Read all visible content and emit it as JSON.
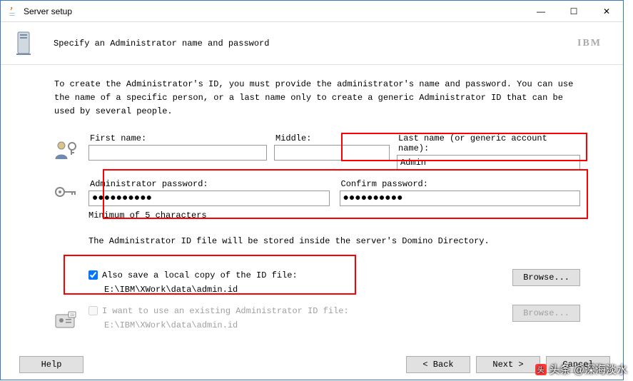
{
  "window": {
    "title": "Server setup"
  },
  "titlebar": {
    "min": "—",
    "max": "☐",
    "close": "✕"
  },
  "header": {
    "subtitle": "Specify an Administrator name and password",
    "brand": "IBM"
  },
  "intro": "To create the Administrator's ID, you must provide the administrator's name and password. You can use the name of a specific person, or a last name only to create a generic Administrator ID that can be used by several people.",
  "name": {
    "first_label": "First name:",
    "first_value": "",
    "middle_label": "Middle:",
    "middle_value": "",
    "last_label": "Last name (or generic account name):",
    "last_value": "Admin"
  },
  "password": {
    "label": "Administrator password:",
    "value": "●●●●●●●●●●",
    "confirm_label": "Confirm password:",
    "confirm_value": "●●●●●●●●●●",
    "hint": "Minimum of 5 characters"
  },
  "storage": {
    "info": "The Administrator ID file will be stored inside the server's Domino Directory.",
    "save_local_label": "Also save a local copy of the ID file:",
    "save_local_checked": true,
    "save_local_path": "E:\\IBM\\XWork\\data\\admin.id",
    "browse_label": "Browse...",
    "existing_label": "I want to use an existing Administrator ID file:",
    "existing_checked": false,
    "existing_path": "E:\\IBM\\XWork\\data\\admin.id",
    "browse2_label": "Browse..."
  },
  "footer": {
    "help": "Help",
    "back": "< Back",
    "next": "Next >",
    "cancel": "Cancel"
  },
  "watermark": "头条 @深海淡水"
}
